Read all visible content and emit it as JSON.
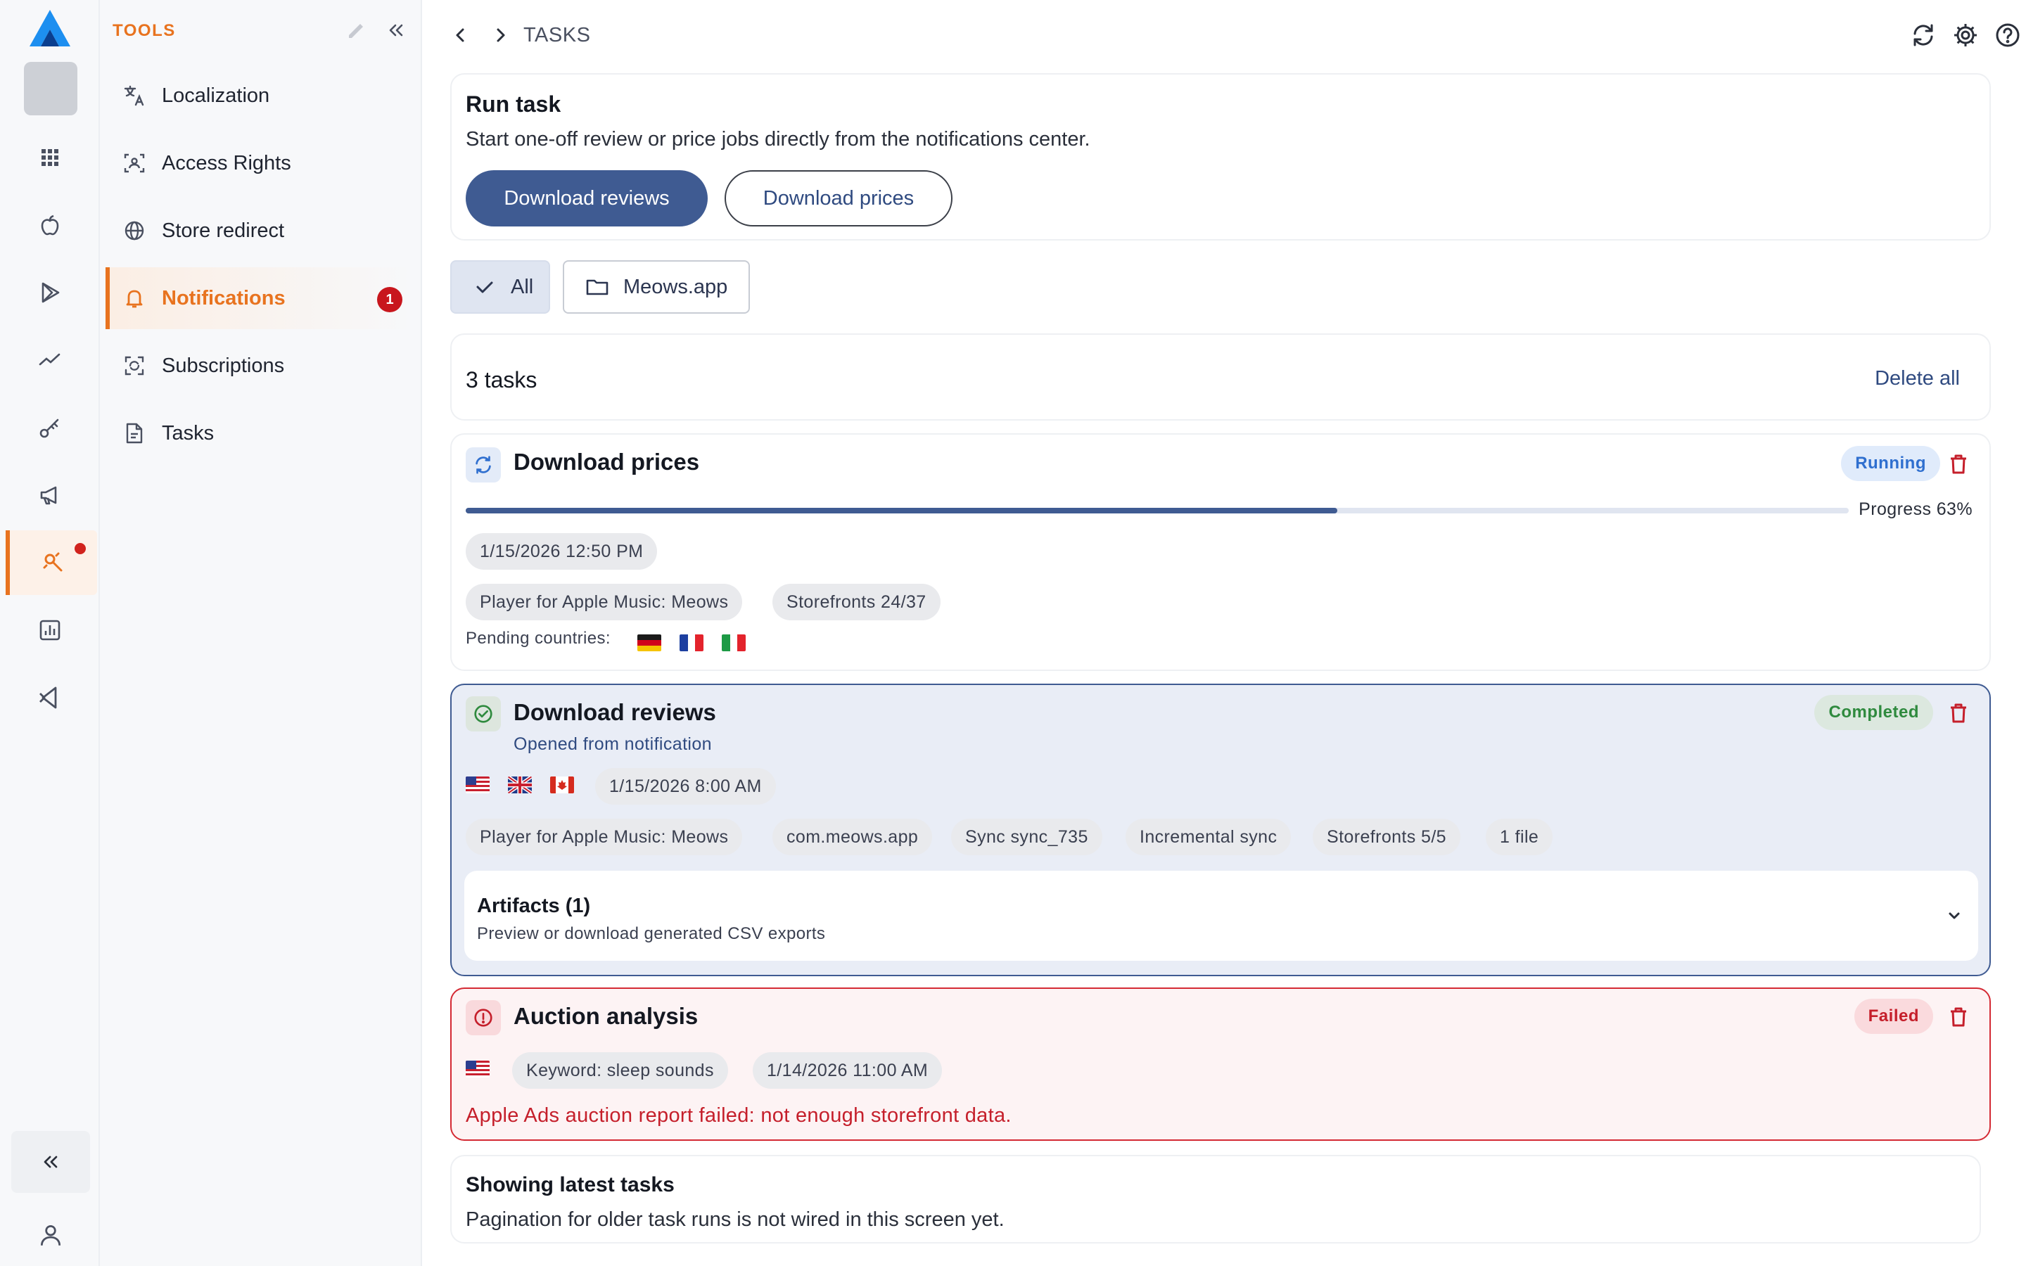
{
  "colors": {
    "accent_orange": "#e8731f",
    "primary_blue": "#3f5b92",
    "running_bg": "#e0ebfb",
    "running_text": "#2f6fcf",
    "completed_bg": "#dce8df",
    "completed_text": "#2f8a3e",
    "failed_bg": "#fadadd",
    "failed_text": "#c51f2b"
  },
  "rail": {
    "icons": [
      "logo-icon",
      "grid-icon",
      "apple-icon",
      "play-store-icon",
      "trend-icon",
      "key-icon",
      "megaphone-icon",
      "tools-icon",
      "chart-icon",
      "vscode-icon",
      "collapse-icon",
      "user-icon"
    ],
    "active": "tools"
  },
  "sidebar": {
    "section_title": "TOOLS",
    "items": [
      {
        "label": "Localization",
        "icon": "translate-icon"
      },
      {
        "label": "Access Rights",
        "icon": "id-card-icon"
      },
      {
        "label": "Store redirect",
        "icon": "globe-icon"
      },
      {
        "label": "Notifications",
        "icon": "bell-icon",
        "badge": "1",
        "active": true
      },
      {
        "label": "Subscriptions",
        "icon": "subscriptions-icon"
      },
      {
        "label": "Tasks",
        "icon": "document-icon"
      }
    ]
  },
  "topbar": {
    "breadcrumb": "TASKS"
  },
  "run_task": {
    "title": "Run task",
    "description": "Start one-off review or price jobs directly from the notifications center.",
    "primary_button": "Download reviews",
    "secondary_button": "Download prices"
  },
  "filters": {
    "all_label": "All",
    "app_label": "Meows.app"
  },
  "task_list": {
    "count_label": "3 tasks",
    "delete_all": "Delete all"
  },
  "tasks": [
    {
      "title": "Download prices",
      "status": "Running",
      "progress": 0.63,
      "progress_label": "Progress 63%",
      "date": "1/15/2026 12:50 PM",
      "pills": [
        "Player for Apple Music: Meows",
        "Storefronts 24/37"
      ],
      "pending_label": "Pending countries:",
      "pending_flags": [
        "DE",
        "FR",
        "IT"
      ]
    },
    {
      "title": "Download reviews",
      "subtitle": "Opened from notification",
      "status": "Completed",
      "flags": [
        "US",
        "GB",
        "CA"
      ],
      "date": "1/15/2026 8:00 AM",
      "pills": [
        "Player for Apple Music: Meows",
        "com.meows.app",
        "Sync sync_735",
        "Incremental sync",
        "Storefronts 5/5",
        "1 file"
      ],
      "artifacts_title": "Artifacts (1)",
      "artifacts_subtitle": "Preview or download generated CSV exports"
    },
    {
      "title": "Auction analysis",
      "status": "Failed",
      "flags": [
        "US"
      ],
      "pills": [
        "Keyword: sleep sounds",
        "1/14/2026 11:00 AM"
      ],
      "error": "Apple Ads auction report failed: not enough storefront data."
    }
  ],
  "footer_info": {
    "title": "Showing latest tasks",
    "description": "Pagination for older task runs is not wired in this screen yet."
  }
}
